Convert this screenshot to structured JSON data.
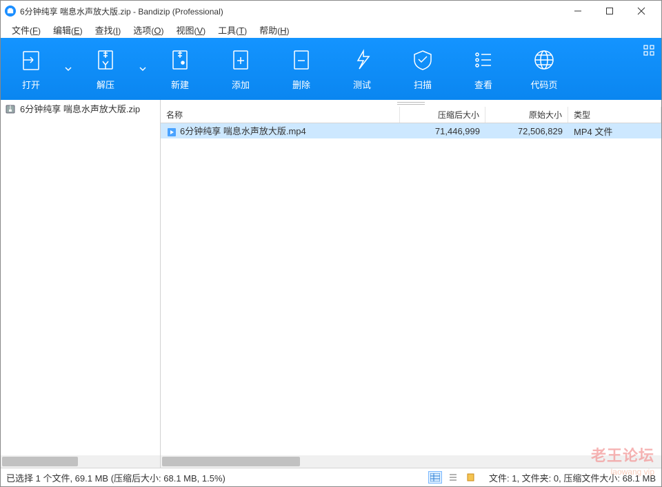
{
  "window": {
    "title": "6分钟纯享 喘息水声放大版.zip - Bandizip (Professional)"
  },
  "menu": {
    "items": [
      {
        "label": "文件",
        "accel": "F"
      },
      {
        "label": "编辑",
        "accel": "E"
      },
      {
        "label": "查找",
        "accel": "I"
      },
      {
        "label": "选项",
        "accel": "O"
      },
      {
        "label": "视图",
        "accel": "V"
      },
      {
        "label": "工具",
        "accel": "T"
      },
      {
        "label": "帮助",
        "accel": "H"
      }
    ]
  },
  "toolbar": {
    "open": "打开",
    "extract": "解压",
    "new": "新建",
    "add": "添加",
    "delete": "删除",
    "test": "测试",
    "scan": "扫描",
    "view": "查看",
    "codepage": "代码页"
  },
  "tree": {
    "root": "6分钟纯享 喘息水声放大版.zip"
  },
  "columns": {
    "name": "名称",
    "packed": "压缩后大小",
    "orig": "原始大小",
    "type": "类型"
  },
  "col_widths": {
    "name": 347,
    "packed": 124,
    "orig": 120,
    "type": 120
  },
  "files": [
    {
      "name": "6分钟纯享 喘息水声放大版.mp4",
      "packed": "71,446,999",
      "orig": "72,506,829",
      "type": "MP4 文件"
    }
  ],
  "status": {
    "left": "已选择 1 个文件, 69.1 MB (压缩后大小: 68.1 MB, 1.5%)",
    "right": "文件: 1, 文件夹: 0, 压缩文件大小: 68.1 MB"
  },
  "watermark": "老王论坛",
  "watermark_sub": "laowang vip"
}
